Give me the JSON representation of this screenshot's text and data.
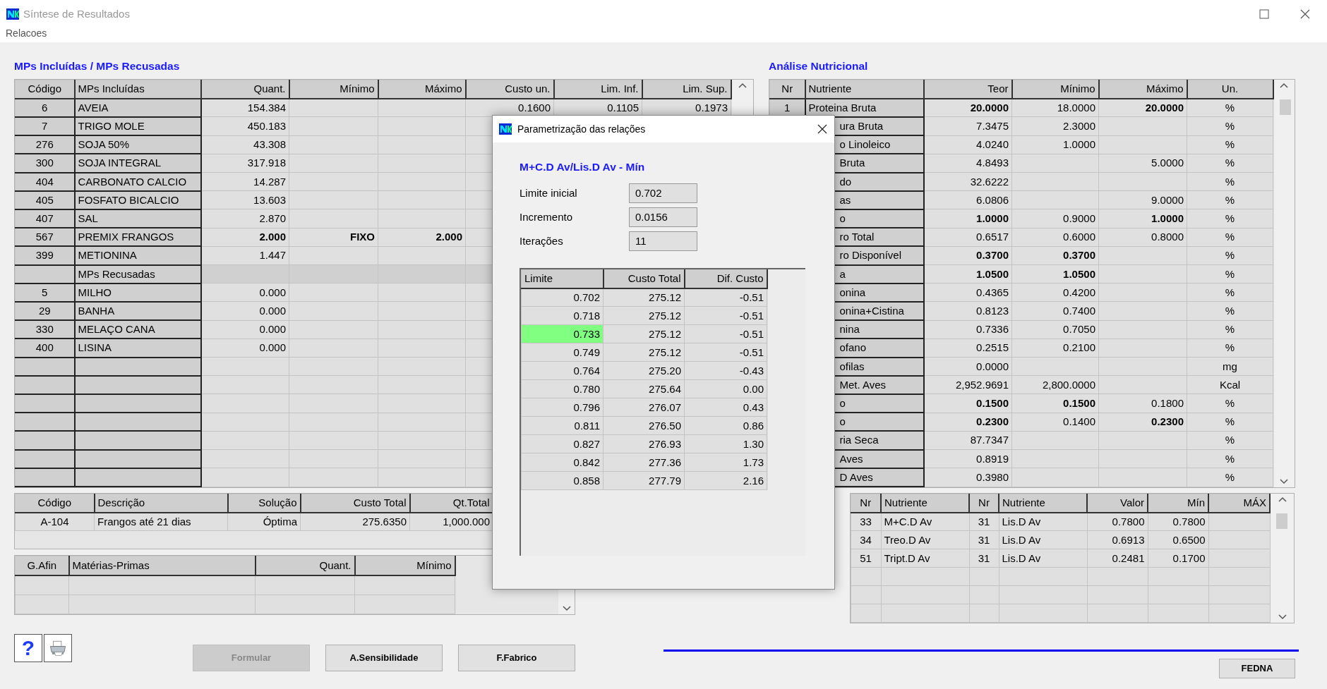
{
  "window": {
    "title": "Síntese de Resultados"
  },
  "menu": [
    "Relacoes"
  ],
  "included_panel": {
    "title": "MPs Incluídas / MPs Recusadas",
    "columns": [
      "Código",
      "MPs Incluídas",
      "Quant.",
      "Mínimo",
      "Máximo",
      "Custo un.",
      "Lim. Inf.",
      "Lim. Sup."
    ],
    "rows": [
      {
        "kind": "item",
        "code": "6",
        "name": "AVEIA",
        "quant": "154.384",
        "custo_un": "0.1600",
        "lim_inf": "0.1105",
        "lim_sup": "0.1973",
        "bold": false
      },
      {
        "kind": "item",
        "code": "7",
        "name": "TRIGO MOLE",
        "quant": "450.183",
        "bold": false
      },
      {
        "kind": "item",
        "code": "276",
        "name": "SOJA 50%",
        "quant": "43.308",
        "bold": false
      },
      {
        "kind": "item",
        "code": "300",
        "name": "SOJA INTEGRAL",
        "quant": "317.918",
        "bold": false
      },
      {
        "kind": "item",
        "code": "404",
        "name": "CARBONATO CALCIO",
        "quant": "14.287",
        "bold": false
      },
      {
        "kind": "item",
        "code": "405",
        "name": "FOSFATO BICALCIO",
        "quant": "13.603",
        "bold": false
      },
      {
        "kind": "item",
        "code": "407",
        "name": "SAL",
        "quant": "2.870",
        "bold": false
      },
      {
        "kind": "item",
        "code": "567",
        "name": "PREMIX FRANGOS",
        "quant": "2.000",
        "minimo": "FIXO",
        "maximo": "2.000",
        "bold": true
      },
      {
        "kind": "item",
        "code": "399",
        "name": "METIONINA",
        "quant": "1.447",
        "bold": false
      },
      {
        "kind": "section",
        "name": "MPs Recusadas"
      },
      {
        "kind": "item",
        "code": "5",
        "name": "MILHO",
        "quant": "0.000",
        "bold": false
      },
      {
        "kind": "item",
        "code": "29",
        "name": "BANHA",
        "quant": "0.000",
        "bold": false
      },
      {
        "kind": "item",
        "code": "330",
        "name": "MELAÇO CANA",
        "quant": "0.000",
        "bold": false
      },
      {
        "kind": "item",
        "code": "400",
        "name": "LISINA",
        "quant": "0.000",
        "bold": false
      }
    ]
  },
  "nutrition_panel": {
    "title": "Análise Nutricional",
    "columns": [
      "Nr",
      "Nutriente",
      "Teor",
      "Mínimo",
      "Máximo",
      "Un."
    ],
    "rows": [
      {
        "nr": "1",
        "name": "Proteina Bruta",
        "teor": {
          "text": "20.0000",
          "bold": true
        },
        "minimo": {
          "text": "18.0000",
          "bold": false
        },
        "maximo": {
          "text": "20.0000",
          "bold": true
        },
        "unit": "%"
      },
      {
        "name": "ura Bruta",
        "teor": {
          "text": "7.3475",
          "bold": false
        },
        "minimo": {
          "text": "2.3000",
          "bold": false
        },
        "unit": "%"
      },
      {
        "name": "o Linoleico",
        "teor": {
          "text": "4.0240",
          "bold": false
        },
        "minimo": {
          "text": "1.0000",
          "bold": false
        },
        "unit": "%"
      },
      {
        "name": "Bruta",
        "teor": {
          "text": "4.8493",
          "bold": false
        },
        "maximo": {
          "text": "5.0000",
          "bold": false
        },
        "unit": "%"
      },
      {
        "name": "do",
        "teor": {
          "text": "32.6222",
          "bold": false
        },
        "unit": "%"
      },
      {
        "name": "as",
        "teor": {
          "text": "6.0806",
          "bold": false
        },
        "maximo": {
          "text": "9.0000",
          "bold": false
        },
        "unit": "%"
      },
      {
        "name": "o",
        "teor": {
          "text": "1.0000",
          "bold": true
        },
        "minimo": {
          "text": "0.9000",
          "bold": false
        },
        "maximo": {
          "text": "1.0000",
          "bold": true
        },
        "unit": "%"
      },
      {
        "name": "ro Total",
        "teor": {
          "text": "0.6517",
          "bold": false
        },
        "minimo": {
          "text": "0.6000",
          "bold": false
        },
        "maximo": {
          "text": "0.8000",
          "bold": false
        },
        "unit": "%"
      },
      {
        "name": "ro Disponível",
        "teor": {
          "text": "0.3700",
          "bold": true
        },
        "minimo": {
          "text": "0.3700",
          "bold": true
        },
        "unit": "%"
      },
      {
        "name": "a",
        "teor": {
          "text": "1.0500",
          "bold": true
        },
        "minimo": {
          "text": "1.0500",
          "bold": true
        },
        "unit": "%"
      },
      {
        "name": "onina",
        "teor": {
          "text": "0.4365",
          "bold": false
        },
        "minimo": {
          "text": "0.4200",
          "bold": false
        },
        "unit": "%"
      },
      {
        "name": "onina+Cistina",
        "teor": {
          "text": "0.8123",
          "bold": false
        },
        "minimo": {
          "text": "0.7400",
          "bold": false
        },
        "unit": "%"
      },
      {
        "name": "nina",
        "teor": {
          "text": "0.7336",
          "bold": false
        },
        "minimo": {
          "text": "0.7050",
          "bold": false
        },
        "unit": "%"
      },
      {
        "name": "ofano",
        "teor": {
          "text": "0.2515",
          "bold": false
        },
        "minimo": {
          "text": "0.2100",
          "bold": false
        },
        "unit": "%"
      },
      {
        "name": "ofilas",
        "teor": {
          "text": "0.0000",
          "bold": false
        },
        "unit": "mg"
      },
      {
        "name": "Met. Aves",
        "teor": {
          "text": "2,952.9691",
          "bold": false
        },
        "minimo": {
          "text": "2,800.0000",
          "bold": false
        },
        "unit": "Kcal"
      },
      {
        "name": "o",
        "teor": {
          "text": "0.1500",
          "bold": true
        },
        "minimo": {
          "text": "0.1500",
          "bold": true
        },
        "maximo": {
          "text": "0.1800",
          "bold": false
        },
        "unit": "%"
      },
      {
        "name": "o",
        "teor": {
          "text": "0.2300",
          "bold": true
        },
        "minimo": {
          "text": "0.1400",
          "bold": false
        },
        "maximo": {
          "text": "0.2300",
          "bold": true
        },
        "unit": "%"
      },
      {
        "name": "ria Seca",
        "teor": {
          "text": "87.7347",
          "bold": false
        },
        "unit": "%"
      },
      {
        "name": "Aves",
        "teor": {
          "text": "0.8919",
          "bold": false
        },
        "unit": "%"
      },
      {
        "name": "D Aves",
        "teor": {
          "text": "0.3980",
          "bold": false
        },
        "unit": "%"
      }
    ]
  },
  "solution_table": {
    "columns": [
      "Código",
      "Descrição",
      "Solução",
      "Custo Total",
      "Qt.Total"
    ],
    "rows": [
      {
        "cells": [
          "A-104",
          "Frangos até 21 dias",
          "Óptima",
          "275.6350",
          "1,000.000"
        ]
      }
    ]
  },
  "affinity_table": {
    "columns": [
      "G.Afin",
      "Matérias-Primas",
      "Quant.",
      "Mínimo"
    ]
  },
  "relations_table": {
    "columns": [
      "Nr",
      "Nutriente",
      "Nr",
      "Nutriente",
      "Valor",
      "Mín",
      "MÁX"
    ],
    "rows": [
      {
        "cells": [
          "33",
          "M+C.D Av",
          "31",
          "Lis.D Av",
          "0.7800",
          "0.7800"
        ]
      },
      {
        "cells": [
          "34",
          "Treo.D Av",
          "31",
          "Lis.D Av",
          "0.6913",
          "0.6500"
        ]
      },
      {
        "cells": [
          "51",
          "Tript.D Av",
          "31",
          "Lis.D Av",
          "0.2481",
          "0.1700"
        ]
      }
    ]
  },
  "help_button": {
    "label": "?"
  },
  "buttons": [
    {
      "label": "Formular",
      "disabled": true
    },
    {
      "label": "A.Sensibilidade",
      "disabled": false
    },
    {
      "label": "F.Fabrico",
      "disabled": false
    }
  ],
  "fedna_button": {
    "label": "FEDNA"
  },
  "dialog": {
    "title": "Parametrização das relações",
    "subtitle": "M+C.D Av/Lis.D Av - Mín",
    "fields": [
      {
        "label": "Limite inicial",
        "value": "0.702"
      },
      {
        "label": "Incremento",
        "value": "0.0156"
      },
      {
        "label": "Iterações",
        "value": "11"
      }
    ],
    "table": {
      "columns": [
        "Limite",
        "Custo Total",
        "Dif. Custo"
      ],
      "rows": [
        {
          "cells": [
            "0.702",
            "275.12",
            "-0.51"
          ],
          "selected": false
        },
        {
          "cells": [
            "0.718",
            "275.12",
            "-0.51"
          ],
          "selected": false
        },
        {
          "cells": [
            "0.733",
            "275.12",
            "-0.51"
          ],
          "selected": true
        },
        {
          "cells": [
            "0.749",
            "275.12",
            "-0.51"
          ],
          "selected": false
        },
        {
          "cells": [
            "0.764",
            "275.20",
            "-0.43"
          ],
          "selected": false
        },
        {
          "cells": [
            "0.780",
            "275.64",
            "0.00"
          ],
          "selected": false
        },
        {
          "cells": [
            "0.796",
            "276.07",
            "0.43"
          ],
          "selected": false
        },
        {
          "cells": [
            "0.811",
            "276.50",
            "0.86"
          ],
          "selected": false
        },
        {
          "cells": [
            "0.827",
            "276.93",
            "1.30"
          ],
          "selected": false
        },
        {
          "cells": [
            "0.842",
            "277.36",
            "1.73"
          ],
          "selected": false
        },
        {
          "cells": [
            "0.858",
            "277.79",
            "2.16"
          ],
          "selected": false
        }
      ]
    }
  }
}
